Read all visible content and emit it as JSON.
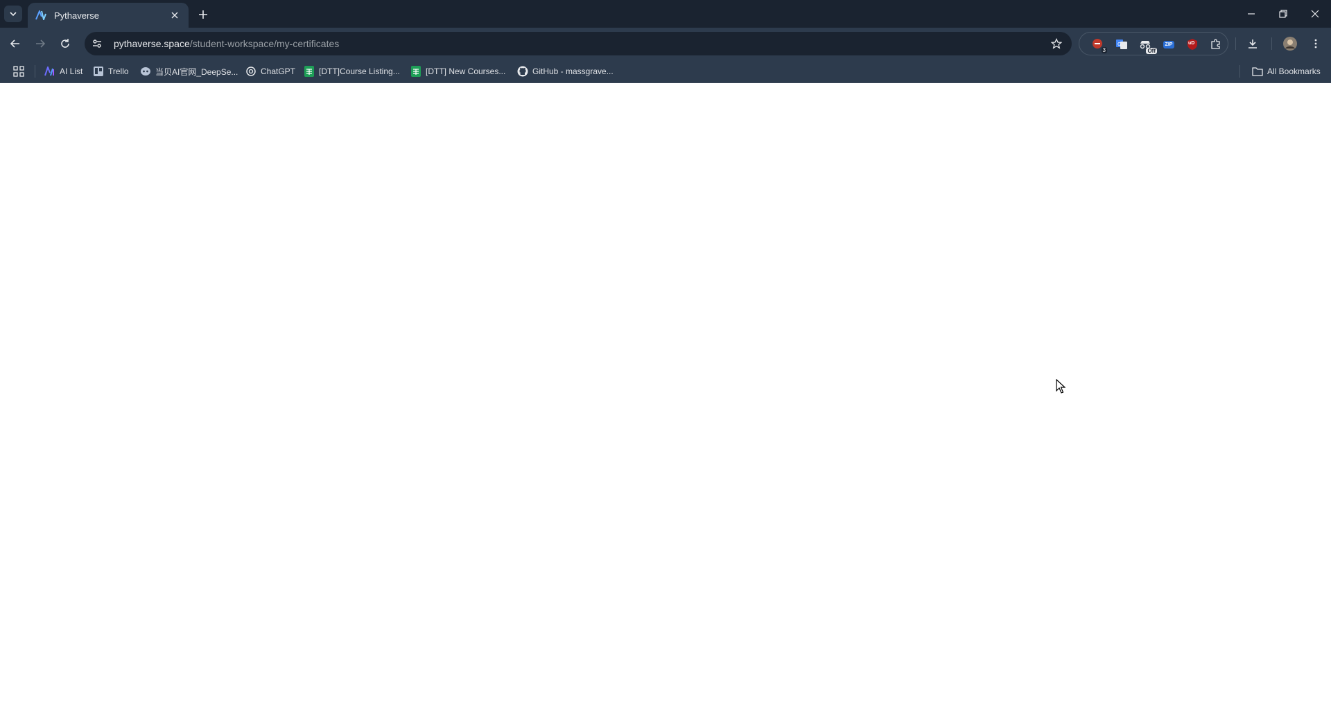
{
  "tab": {
    "title": "Pythaverse"
  },
  "address_bar": {
    "host": "pythaverse.space",
    "path": "/student-workspace/my-certificates"
  },
  "extensions": [
    {
      "name": "extension-badge-3",
      "badge": "3"
    },
    {
      "name": "translate-extension",
      "badge": ""
    },
    {
      "name": "incognito-off-extension",
      "badge": "Off"
    },
    {
      "name": "zip-extension",
      "badge": "ZIP"
    },
    {
      "name": "ublock-extension",
      "badge": "uD"
    }
  ],
  "bookmarks": {
    "items": [
      {
        "label": "AI List",
        "icon": "ai-list-icon"
      },
      {
        "label": "Trello",
        "icon": "trello-icon"
      },
      {
        "label": "当贝AI官网_DeepSe...",
        "icon": "dangbei-icon"
      },
      {
        "label": "ChatGPT",
        "icon": "chatgpt-icon"
      },
      {
        "label": "[DTT]Course Listing...",
        "icon": "sheets-icon"
      },
      {
        "label": "[DTT] New Courses...",
        "icon": "sheets-icon"
      },
      {
        "label": "GitHub - massgrave...",
        "icon": "github-icon"
      }
    ],
    "all_bookmarks_label": "All Bookmarks"
  },
  "colors": {
    "chrome_dark": "#1a2330",
    "chrome_toolbar": "#2d3b4d",
    "page_bg": "#ffffff"
  }
}
